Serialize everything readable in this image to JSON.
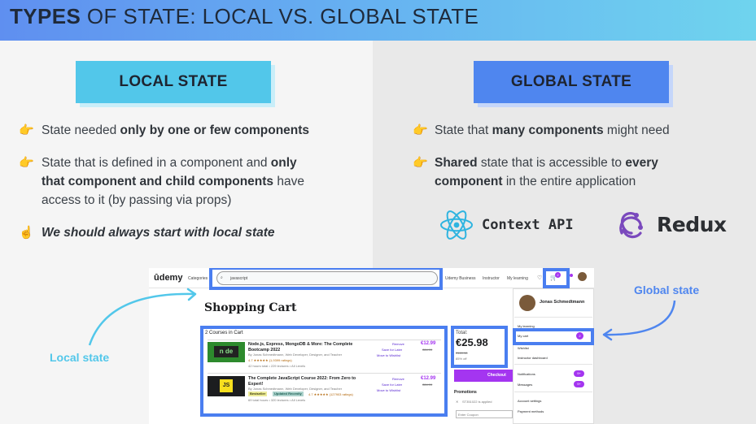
{
  "header": {
    "title_bold": "TYPES",
    "title_rest": "OF STATE: LOCAL VS. GLOBAL STATE"
  },
  "left": {
    "pill": "LOCAL STATE",
    "b1": {
      "pre": "State needed ",
      "bold": "only by one or few components"
    },
    "b2": {
      "pre": "State that is defined in a component and ",
      "bold1": "only",
      "bold2": "that component and child components",
      "post1": " have",
      "post2": "access to it (by passing via props)"
    },
    "b3": "We should always start with local state"
  },
  "right": {
    "pill": "GLOBAL STATE",
    "b1": {
      "pre": "State that ",
      "bold": "many components",
      "post": " might need"
    },
    "b2": {
      "bold1": "Shared",
      "mid": " state that is accessible to ",
      "bold2": "every",
      "bold3": "component",
      "post": " in the entire application"
    },
    "context_label": "Context API",
    "redux_label": "Redux"
  },
  "annotations": {
    "local": "Local state",
    "global": "Global state"
  },
  "udemy": {
    "logo": "ûdemy",
    "categories": "Categories",
    "search_value": "javascript",
    "nav": [
      "Udemy Business",
      "Instructor",
      "My learning"
    ],
    "cart_badge": "2",
    "page_title": "Shopping Cart",
    "courses_count": "2 Courses in Cart",
    "courses": [
      {
        "thumb": "n de",
        "title": "Node.js, Express, MongoDB & More: The Complete Bootcamp 2022",
        "author": "By Jonas Schmedtmann, Web Developer, Designer, and Teacher",
        "rating": "4.7 ★★★★★ (1,9399 ratings)",
        "meta": "42 hours total • 229 lectures • All Levels",
        "actions": [
          "Remove",
          "Save for Later",
          "Move to Wishlist"
        ],
        "price": "€12.99",
        "old_price": "€84.99",
        "badges": []
      },
      {
        "thumb": "JS",
        "title": "The Complete JavaScript Course 2022: From Zero to Expert!",
        "author": "By Jonas Schmedtmann, Web Developer, Designer, and Teacher",
        "rating": "4.7 ★★★★★ (127903 ratings)",
        "meta": "69 total hours • 320 lectures • All Levels",
        "actions": [
          "Remove",
          "Save for Later",
          "Move to Wishlist"
        ],
        "price": "€12.99",
        "old_price": "€84.99",
        "badges": [
          "Bestseller",
          "Updated Recently"
        ]
      }
    ],
    "total_label": "Total:",
    "total": "€25.98",
    "total_old": "€169.98",
    "discount": "85% off",
    "checkout": "Checkout",
    "promotions": "Promotions",
    "coupon": "ST351022 is applied",
    "coupon_placeholder": "Enter Coupon",
    "menu": {
      "user": "Jonas Schmedtmann",
      "items": [
        "My learning",
        "My cart",
        "Wishlist",
        "Instructor dashboard",
        "Notifications",
        "Messages",
        "Account settings",
        "Payment methods"
      ],
      "cart_count": "2",
      "notif_count": "9+",
      "msg_count": "9+"
    }
  },
  "colors": {
    "local": "#52c7ea",
    "global": "#4f86ef",
    "highlight": "#4a7ef0",
    "udemy_purple": "#a435f0"
  }
}
